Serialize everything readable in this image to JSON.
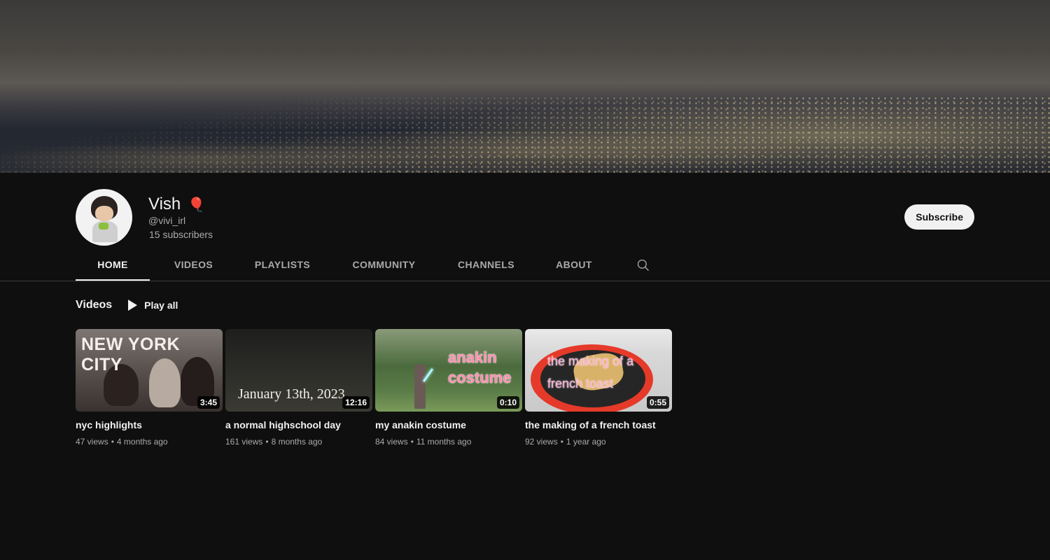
{
  "channel": {
    "name": "Vish",
    "name_emoji": "🎈",
    "handle": "@vivi_irl",
    "subscribers": "15 subscribers",
    "subscribe_label": "Subscribe"
  },
  "tabs": [
    {
      "label": "HOME",
      "active": true
    },
    {
      "label": "VIDEOS",
      "active": false
    },
    {
      "label": "PLAYLISTS",
      "active": false
    },
    {
      "label": "COMMUNITY",
      "active": false
    },
    {
      "label": "CHANNELS",
      "active": false
    },
    {
      "label": "ABOUT",
      "active": false
    }
  ],
  "search_icon": "search-icon",
  "section": {
    "title": "Videos",
    "play_all_label": "Play all",
    "play_icon": "play-icon"
  },
  "videos": [
    {
      "title": "nyc highlights",
      "views": "47 views",
      "age": "4 months ago",
      "duration": "3:45",
      "thumb_text": "NEW YORK CITY"
    },
    {
      "title": "a normal highschool day",
      "views": "161 views",
      "age": "8 months ago",
      "duration": "12:16",
      "thumb_text": "January 13th, 2023"
    },
    {
      "title": "my anakin costume",
      "views": "84 views",
      "age": "11 months ago",
      "duration": "0:10",
      "thumb_text": "anakin costume"
    },
    {
      "title": "the making of a french toast",
      "views": "92 views",
      "age": "1 year ago",
      "duration": "0:55",
      "thumb_text": "the making of a french toast"
    }
  ],
  "colors": {
    "background": "#0f0f0f",
    "text_primary": "#f1f1f1",
    "text_secondary": "#aaaaaa",
    "subscribe_bg": "#f1f1f1"
  }
}
